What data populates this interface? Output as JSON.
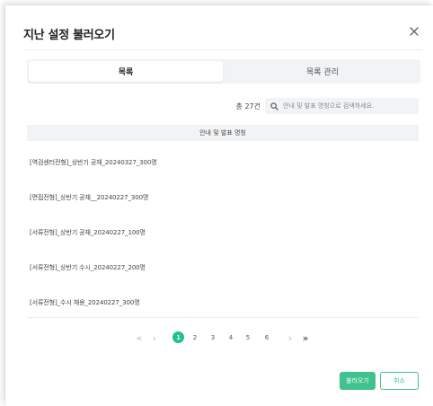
{
  "dialog": {
    "title": "지난 설정 불러오기",
    "close_icon": "close-icon"
  },
  "tabs": [
    {
      "label": "목록",
      "active": true
    },
    {
      "label": "목록 관리",
      "active": false
    }
  ],
  "summary": {
    "count_label": "총 27건"
  },
  "search": {
    "placeholder": "안내 및 발표 명칭으로 검색하세요.",
    "value": ""
  },
  "table": {
    "header": "안내 및 발표 명칭"
  },
  "items": [
    {
      "label": "[역검센터전형]_상반기 공채_20240327_300명"
    },
    {
      "label": "[면접전형]_상반기 공채__20240227_300명"
    },
    {
      "label": "[서류전형]_상반기 공채_20240227_100명"
    },
    {
      "label": "[서류전형]_상반기 수시_20240227_200명"
    },
    {
      "label": "[서류전형]_수시 채용_20240227_300명"
    }
  ],
  "pagination": {
    "first": "«",
    "prev": "‹",
    "next": "›",
    "last": "»",
    "pages": [
      "1",
      "2",
      "3",
      "4",
      "5",
      "6"
    ],
    "current": "1"
  },
  "actions": {
    "load_label": "불러오기",
    "cancel_label": "취소"
  },
  "colors": {
    "accent": "#1ec28b",
    "surface": "#f2f3f5"
  }
}
